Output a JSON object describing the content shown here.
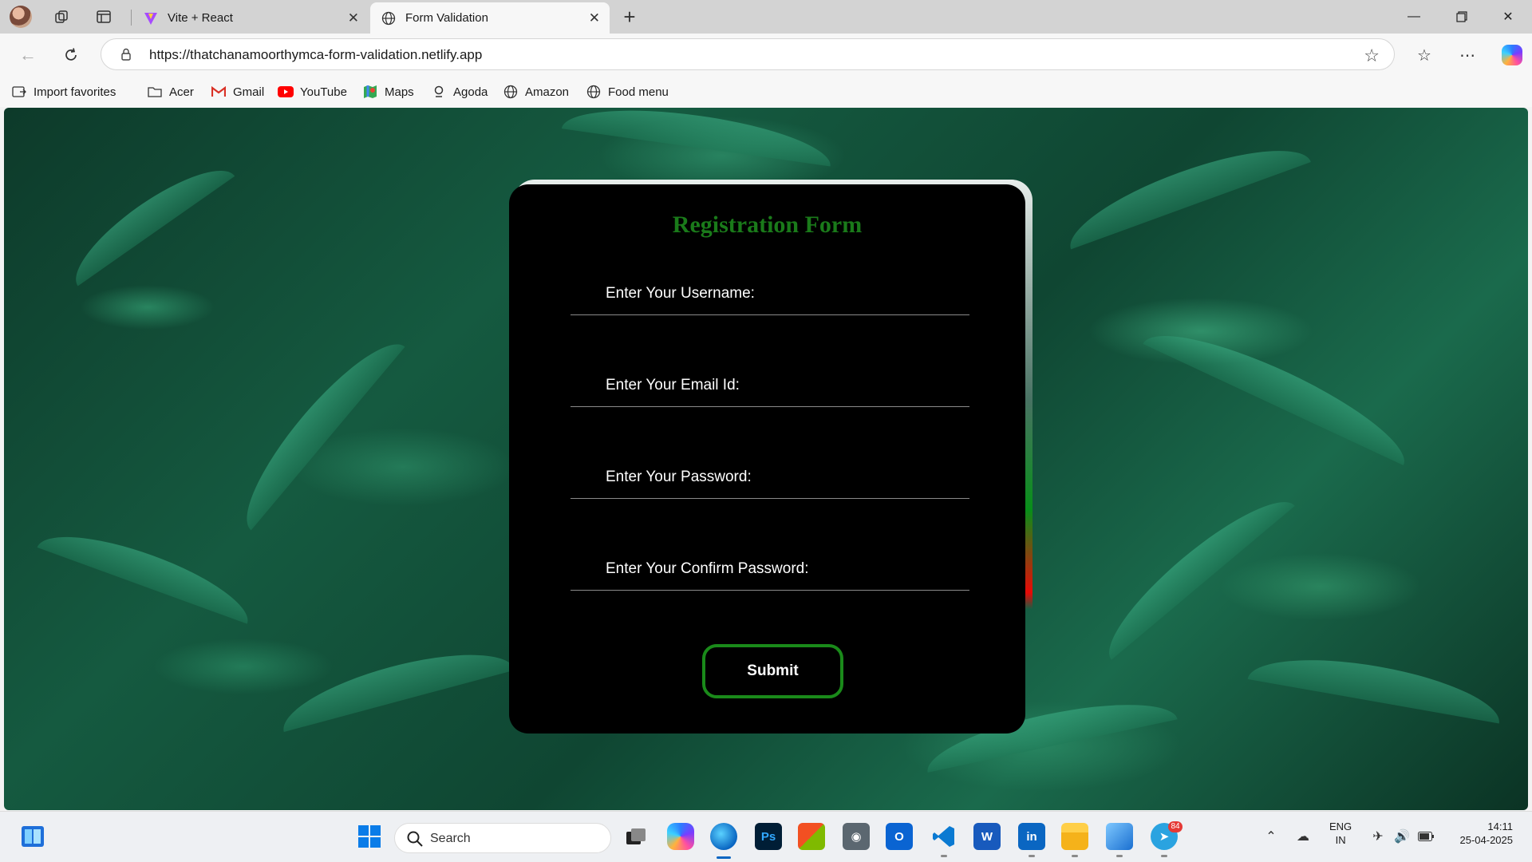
{
  "browser": {
    "tabs": [
      {
        "title": "Vite + React",
        "active": false
      },
      {
        "title": "Form Validation",
        "active": true
      }
    ],
    "url": "https://thatchanamoorthymca-form-validation.netlify.app",
    "favorites": [
      {
        "label": "Import favorites",
        "icon": "import-icon"
      },
      {
        "label": "Acer",
        "icon": "folder-icon"
      },
      {
        "label": "Gmail",
        "icon": "gmail-icon"
      },
      {
        "label": "YouTube",
        "icon": "youtube-icon"
      },
      {
        "label": "Maps",
        "icon": "maps-icon"
      },
      {
        "label": "Agoda",
        "icon": "agoda-icon"
      },
      {
        "label": "Amazon",
        "icon": "globe-icon"
      },
      {
        "label": "Food menu",
        "icon": "globe-icon"
      }
    ]
  },
  "form": {
    "title": "Registration Form",
    "title_color": "#1a7a1a",
    "fields": [
      {
        "label": "Enter Your Username:",
        "value": ""
      },
      {
        "label": "Enter Your Email Id:",
        "value": ""
      },
      {
        "label": "Enter Your Password:",
        "value": ""
      },
      {
        "label": "Enter Your Confirm Password:",
        "value": ""
      }
    ],
    "submit_label": "Submit",
    "accent_color": "#1a8a1a"
  },
  "taskbar": {
    "search_placeholder": "Search",
    "telegram_badge": "84",
    "language": {
      "line1": "ENG",
      "line2": "IN"
    },
    "clock": {
      "time": "14:11",
      "date": "25-04-2025"
    }
  }
}
